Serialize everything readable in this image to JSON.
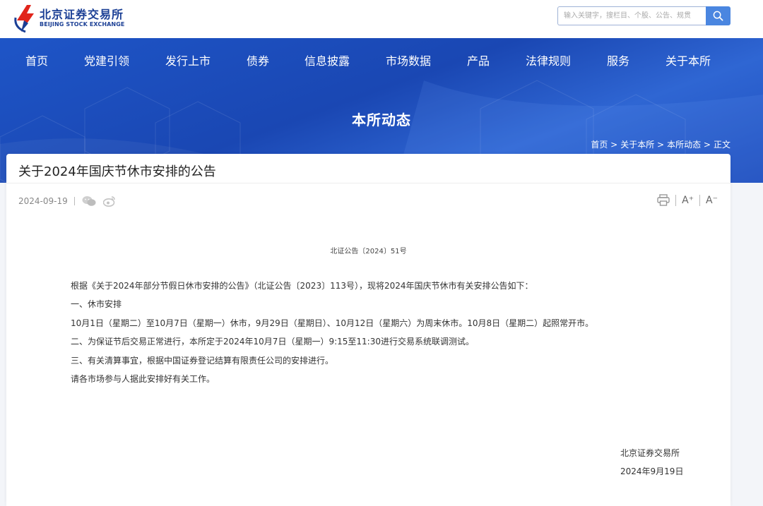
{
  "header": {
    "logo_cn": "北京证券交易所",
    "logo_en": "BEIJING STOCK EXCHANGE",
    "search_placeholder": "输入关键字，搜栏目、个股、公告、规贯"
  },
  "nav": {
    "items": [
      "首页",
      "党建引领",
      "发行上市",
      "债券",
      "信息披露",
      "市场数据",
      "产品",
      "法律规则",
      "服务",
      "关于本所"
    ]
  },
  "banner": {
    "title": "本所动态"
  },
  "breadcrumb": {
    "items": [
      "首页 >",
      "关于本所 >",
      "本所动态 >",
      "正文"
    ]
  },
  "article": {
    "title": "关于2024年国庆节休市安排的公告",
    "date": "2024-09-19",
    "font_increase": "A⁺",
    "font_decrease": "A⁻",
    "doc_number": "北证公告〔2024〕51号",
    "paragraphs": [
      "根据《关于2024年部分节假日休市安排的公告》（北证公告〔2023〕113号），现将2024年国庆节休市有关安排公告如下：",
      "一、休市安排",
      "10月1日（星期二）至10月7日（星期一）休市，9月29日（星期日）、10月12日（星期六）为周末休市。10月8日（星期二）起照常开市。",
      "二、为保证节后交易正常进行，本所定于2024年10月7日（星期一）9:15至11:30进行交易系统联调测试。",
      "三、有关清算事宜，根据中国证券登记结算有限责任公司的安排进行。",
      "请各市场参与人据此安排好有关工作。"
    ],
    "signature_org": "北京证券交易所",
    "signature_date": "2024年9月19日"
  },
  "colors": {
    "brand_blue": "#1b3f95",
    "banner_blue": "#1e55c7",
    "search_button": "#4a86e0",
    "logo_red": "#e1251b"
  }
}
